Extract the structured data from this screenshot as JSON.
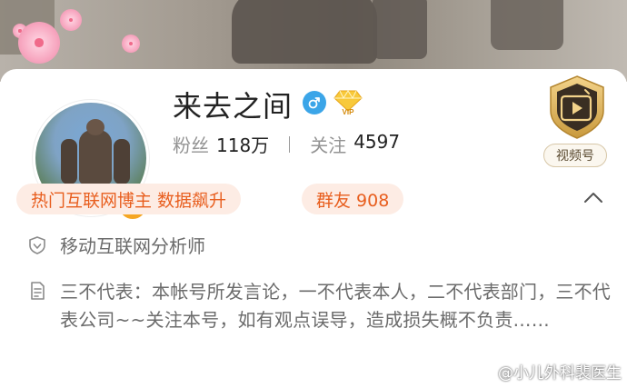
{
  "profile": {
    "name": "来去之间",
    "gender_icon": "male-icon",
    "vip_icon": "vip-diamond-icon",
    "vip_text": "VIP",
    "verified_badge": "v-verified-badge"
  },
  "stats": {
    "followers_label": "粉丝",
    "followers_value": "118万",
    "following_label": "关注",
    "following_value": "4597"
  },
  "video_account": {
    "label": "视频号",
    "icon": "play-shield-icon"
  },
  "tags": [
    {
      "label": "热门互联网博主 数据飙升"
    },
    {
      "label": "群友 908"
    }
  ],
  "auth": {
    "icon": "shield-check-icon",
    "text": "移动互联网分析师"
  },
  "bio": {
    "icon": "document-icon",
    "text": "三不代表：本帐号所发言论，一不代表本人，二不代表部门，三不代表公司~~关注本号，如有观点误导，造成损失概不负责……"
  },
  "watermark": {
    "text": "@小儿外科裴医生"
  },
  "colors": {
    "accent_orange": "#e85e1e",
    "tag_bg": "#fdece4",
    "gender_blue": "#3ba5e8",
    "badge_gold": "#f5a623"
  }
}
